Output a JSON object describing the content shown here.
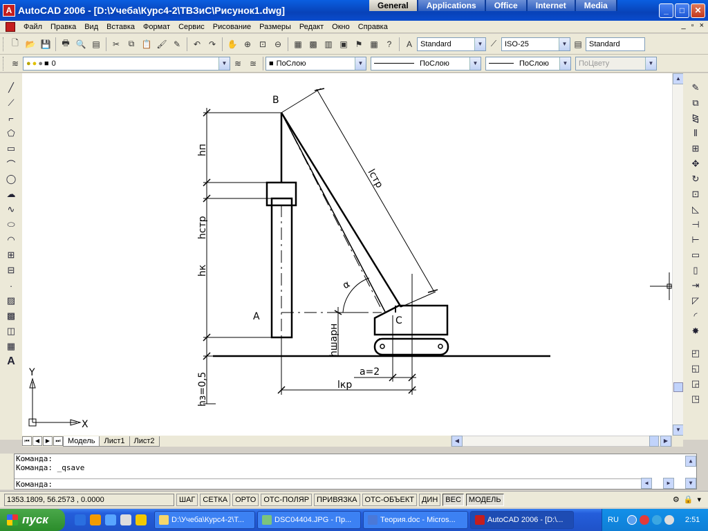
{
  "window": {
    "title": "AutoCAD 2006 - [D:\\Учеба\\Курс4-2\\ТВЗиС\\Рисунок1.dwg]",
    "workspace_tabs": [
      "General",
      "Applications",
      "Office",
      "Internet",
      "Media"
    ],
    "active_workspace_tab": "General",
    "buttons": {
      "minimize": "_",
      "maximize": "□",
      "close": "✕"
    }
  },
  "menu": {
    "items": [
      "Файл",
      "Правка",
      "Вид",
      "Вставка",
      "Формат",
      "Сервис",
      "Рисование",
      "Размеры",
      "Редакт",
      "Окно",
      "Справка"
    ],
    "doc_buttons": [
      "_",
      "▫",
      "×"
    ]
  },
  "toolbar_standard": {
    "text_style": "Standard",
    "dim_style": "ISO-25",
    "table_style": "Standard"
  },
  "toolbar_layers": {
    "layer": "0",
    "color": "ПоСлою",
    "linetype": "ПоСлою",
    "lineweight": "ПоСлою",
    "plotstyle": "ПоЦвету"
  },
  "drawing": {
    "labels": {
      "point_b": "B",
      "point_a": "A",
      "point_c": "C",
      "h_p": "hп",
      "h_str": "hстр",
      "h_k": "hк",
      "h_z": "hз=0,5",
      "h_sharn": "hшарн",
      "l_str": "lстр",
      "l_kr": "lкр",
      "a_dim": "a=2",
      "alpha": "α"
    },
    "ucs": {
      "x": "X",
      "y": "Y"
    }
  },
  "layout_tabs": [
    "Модель",
    "Лист1",
    "Лист2"
  ],
  "active_layout_tab": "Модель",
  "command_line": {
    "history": [
      "Команда:",
      "Команда: _qsave"
    ],
    "prompt": "Команда:"
  },
  "status": {
    "coords": "1353.1809, 56.2573 , 0.0000",
    "modes": [
      "ШАГ",
      "СЕТКА",
      "ОРТО",
      "ОТС-ПОЛЯР",
      "ПРИВЯЗКА",
      "ОТС-ОБЪЕКТ",
      "ДИН",
      "ВЕС",
      "МОДЕЛЬ"
    ],
    "pressed_modes": [
      "ВЕС",
      "МОДЕЛЬ"
    ]
  },
  "taskbar": {
    "start": "пуск",
    "tasks": [
      "D:\\Учеба\\Курс4-2\\Т...",
      "DSC04404.JPG - Пр...",
      "Теория.doc - Micros...",
      "AutoCAD 2006 - [D:\\..."
    ],
    "active_task": 3,
    "lang": "RU",
    "clock": "2:51"
  },
  "colors": {
    "titlebar": "#0a4ccd",
    "drawing_bg": "#ffffff",
    "taskbar": "#245edb",
    "start_button": "#2b8c2b"
  }
}
